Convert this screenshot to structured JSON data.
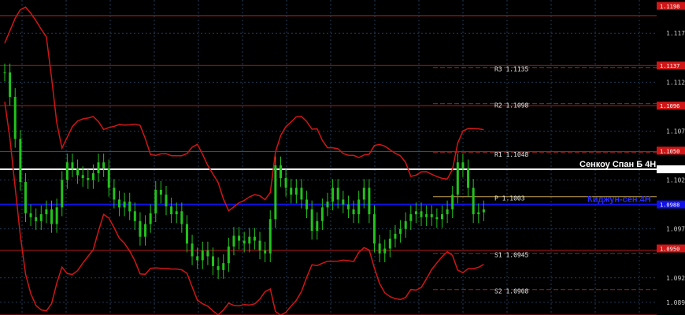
{
  "chart_data": {
    "type": "candlestick",
    "y_axis": {
      "ylim": [
        1.0882,
        1.1204
      ],
      "ticks": [
        1.117,
        1.112,
        1.107,
        1.102,
        1.097,
        1.092,
        1.0895
      ]
    },
    "colors": {
      "background": "#000000",
      "candles": "#22c31c",
      "bands": "#d01616",
      "levels": "#b81a1a",
      "grid": "#1f3b57",
      "senkou": "#ffffff",
      "kijun": "#1010e8",
      "pivot": "#c4a24a"
    },
    "price_tags": [
      {
        "value": 1.1198,
        "text": "1.1198"
      },
      {
        "value": 1.1137,
        "text": "1.1137"
      },
      {
        "value": 1.1096,
        "text": "1.1096"
      },
      {
        "value": 1.105,
        "text": "1.1050"
      },
      {
        "value": 1.095,
        "text": "1.0950"
      }
    ],
    "red_levels": [
      1.1188,
      1.1137,
      1.1096,
      1.1049,
      1.0948,
      1.0882
    ],
    "pivot_levels": [
      {
        "name": "R3",
        "value": 1.1135,
        "label": "R3  1.1135"
      },
      {
        "name": "R2",
        "value": 1.1098,
        "label": "R2  1.1098"
      },
      {
        "name": "R1",
        "value": 1.1048,
        "label": "R1  1.1048"
      },
      {
        "name": "P",
        "value": 1.1003,
        "label": "P  1.1003"
      },
      {
        "name": "S1",
        "value": 1.0945,
        "label": "S1  1.0945"
      },
      {
        "name": "S2",
        "value": 1.0908,
        "label": "S2  1.0908"
      }
    ],
    "indicator_lines": [
      {
        "name": "senkou",
        "value": 1.1031,
        "label": "Сенкоу Спан Б 4Н",
        "tag": "1.1031"
      },
      {
        "name": "kijun",
        "value": 1.0995,
        "label": "Киджун-сен 4Н",
        "tag": "1.0988"
      }
    ],
    "closes": [
      1.113,
      1.1105,
      1.1062,
      1.1018,
      1.0986,
      1.0982,
      1.0978,
      1.0985,
      1.099,
      1.0975,
      1.0992,
      1.102,
      1.1038,
      1.1032,
      1.1025,
      1.1022,
      1.102,
      1.1027,
      1.1038,
      1.1032,
      1.1012,
      1.1,
      1.0992,
      1.0998,
      1.0988,
      1.0978,
      1.0962,
      1.0975,
      1.0986,
      1.101,
      1.1005,
      1.0993,
      1.0985,
      1.0988,
      1.0975,
      1.0955,
      1.0942,
      1.0938,
      1.0948,
      1.0942,
      1.0932,
      1.0928,
      1.0935,
      1.0952,
      1.0963,
      1.0958,
      1.0955,
      1.0962,
      1.0958,
      1.0948,
      1.0945,
      1.098,
      1.1035,
      1.1022,
      1.1012,
      1.1005,
      1.1012,
      1.1,
      1.099,
      1.0968,
      1.0978,
      1.0992,
      1.0998,
      1.1012,
      1.1,
      1.0995,
      1.099,
      1.0985,
      1.1,
      1.1012,
      1.0985,
      1.0955,
      1.0945,
      1.095,
      1.096,
      1.0965,
      1.097,
      1.0978,
      1.0985,
      1.0988,
      1.0982,
      1.0985,
      1.0982,
      1.098,
      1.0985,
      1.099,
      1.1005,
      1.1038,
      1.1032,
      1.1012,
      1.0985,
      1.0987,
      1.099
    ]
  }
}
